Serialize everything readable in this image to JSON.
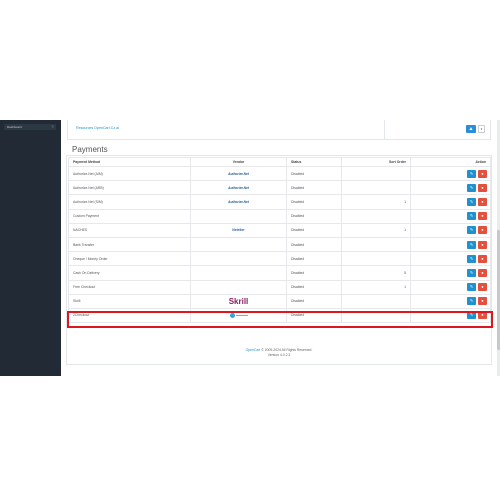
{
  "sidebar": {
    "menu_label": "Dashboard",
    "chev": "≡"
  },
  "top_link": "Resources OpenCart.Cz.ai",
  "heading": "Payments",
  "columns": {
    "method": "Payment Method",
    "vendor": "Vendor",
    "status": "Status",
    "sort": "Sort Order",
    "action": "Action"
  },
  "rows": [
    {
      "method": "Authorize.Net (AIM)",
      "vendor": "Authorize.Net",
      "vendor_type": "authorize",
      "status": "Disabled",
      "sort": ""
    },
    {
      "method": "Authorize.Net (ARB)",
      "vendor": "Authorize.Net",
      "vendor_type": "authorize",
      "status": "Disabled",
      "sort": ""
    },
    {
      "method": "Authorize.Net (SIM)",
      "vendor": "Authorize.Net",
      "vendor_type": "authorize",
      "status": "Disabled",
      "sort": "1"
    },
    {
      "method": "Custom Payment",
      "vendor": "",
      "vendor_type": "none",
      "status": "Disabled",
      "sort": ""
    },
    {
      "method": "NACHES",
      "vendor": "Neteller",
      "vendor_type": "neteller",
      "status": "Disabled",
      "sort": "1"
    },
    {
      "method": "Bank Transfer",
      "vendor": "",
      "vendor_type": "none",
      "status": "Disabled",
      "sort": ""
    },
    {
      "method": "Cheque / Money Order",
      "vendor": "",
      "vendor_type": "none",
      "status": "Disabled",
      "sort": ""
    },
    {
      "method": "Cash On Delivery",
      "vendor": "",
      "vendor_type": "none",
      "status": "Disabled",
      "sort": "5"
    },
    {
      "method": "Free Checkout",
      "vendor": "",
      "vendor_type": "none",
      "status": "Disabled",
      "sort": "1"
    },
    {
      "method": "Skrill",
      "vendor": "Skrill",
      "vendor_type": "skrill",
      "status": "Disabled",
      "sort": ""
    },
    {
      "method": "2Checkout",
      "vendor": "",
      "vendor_type": "2co",
      "status": "Disabled",
      "sort": ""
    }
  ],
  "icons": {
    "edit": "✎",
    "delete": "●",
    "up": "▲",
    "dropdown": "▾"
  },
  "footer": {
    "brand": "OpenCart",
    "copy": " © 2009-2024 All Rights Reserved.",
    "version": "Version 4.0.2.3"
  },
  "colors": {
    "edit": "#1e91cf",
    "delete": "#e3503e",
    "highlight": "#e0161f",
    "sidebar": "#222b35"
  }
}
